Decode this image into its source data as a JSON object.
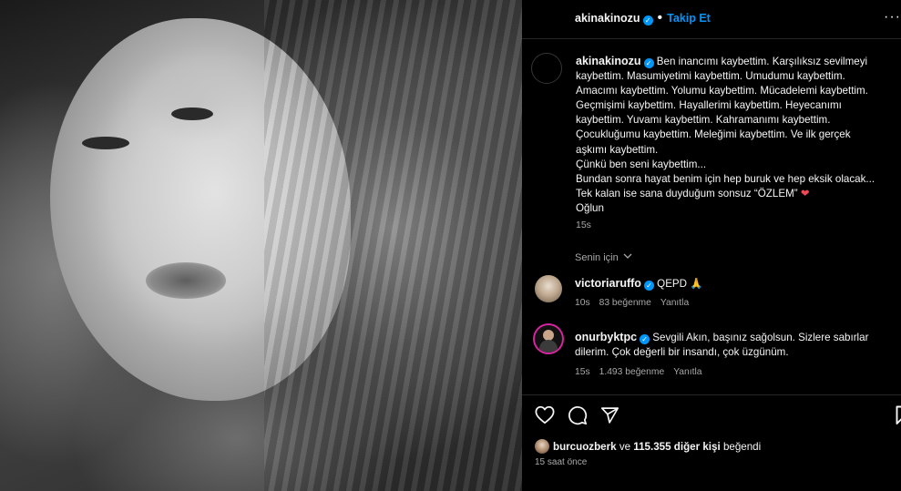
{
  "post": {
    "username": "akinakinozu",
    "follow_label": "Takip Et",
    "dot": "•",
    "more": "···"
  },
  "caption": {
    "username": "akinakinozu",
    "lines": [
      "Ben inancımı kaybettim. Karşılıksız sevilmeyi",
      "kaybettim. Masumiyetimi kaybettim. Umudumu kaybettim.",
      "Amacımı kaybettim. Yolumu kaybettim. Mücadelemi kaybettim.",
      "Geçmişimi kaybettim. Hayallerimi kaybettim. Heyecanımı",
      "kaybettim. Yuvamı kaybettim. Kahramanımı kaybettim.",
      "Çocukluğumu kaybettim. Meleğimi kaybettim. Ve ilk gerçek",
      "aşkımı kaybettim.",
      "Çünkü ben seni kaybettim...",
      "Bundan sonra hayat benim için hep buruk ve hep eksik olacak...",
      "Tek kalan ise sana duyduğum sonsuz “ÖZLEM”",
      "Oğlun"
    ],
    "heart": "❤",
    "time": "15s"
  },
  "filter": {
    "label": "Senin için"
  },
  "comments": [
    {
      "username": "victoriaruffo",
      "text": "QEPD 🙏",
      "time": "10s",
      "likes": "83 beğenme",
      "reply": "Yanıtla"
    },
    {
      "username": "onurbyktpc",
      "text_line1": "Sevgili Akın, başınız sağolsun. Sizlere sabırlar",
      "text_line2": "dilerim. Çok değerli bir insandı, çok üzgünüm.",
      "time": "15s",
      "likes": "1.493 beğenme",
      "reply": "Yanıtla"
    }
  ],
  "likes_line": {
    "user": "burcuozberk",
    "middle": "ve",
    "others": "115.355 diğer kişi",
    "suffix": "beğendi"
  },
  "post_time": "15 saat önce",
  "icons": [
    "heart-icon",
    "comment-icon",
    "share-icon",
    "bookmark-icon",
    "verified-icon",
    "chevron-down-icon"
  ],
  "colors": {
    "accent": "#0095f6",
    "background": "#000000",
    "muted": "#a8a8a8",
    "heart": "#ed4956"
  }
}
